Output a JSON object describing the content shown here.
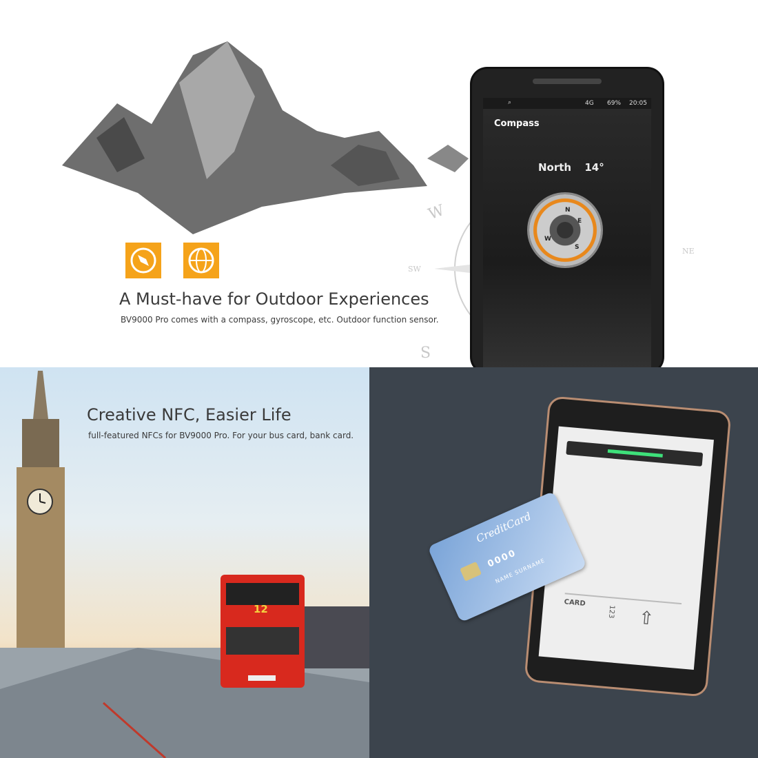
{
  "outdoor": {
    "headline": "A Must-have for Outdoor Experiences",
    "subtext": "BV9000 Pro comes with a compass, gyroscope, etc. Outdoor function sensor.",
    "icons": [
      "compass-icon",
      "globe-icon"
    ],
    "accent_color": "#f5a31a",
    "phone": {
      "status_network": "4G",
      "status_battery": "69%",
      "status_time": "20:05",
      "app_title": "Compass",
      "direction": "North",
      "degrees": "14°",
      "dial_letters": [
        "E",
        "S",
        "W",
        "N"
      ]
    },
    "rose_letters": [
      "W",
      "SW",
      "S",
      "NE"
    ]
  },
  "nfc": {
    "headline": "Creative NFC, Easier Life",
    "subtext": "full-featured NFCs for BV9000 Pro. For your bus card, bank card.",
    "bus_number": "12"
  },
  "card": {
    "brand": "CreditCard",
    "number": "0000",
    "name_label": "NAME SURNAME",
    "slot_label": "CARD",
    "slot_code": "123"
  }
}
